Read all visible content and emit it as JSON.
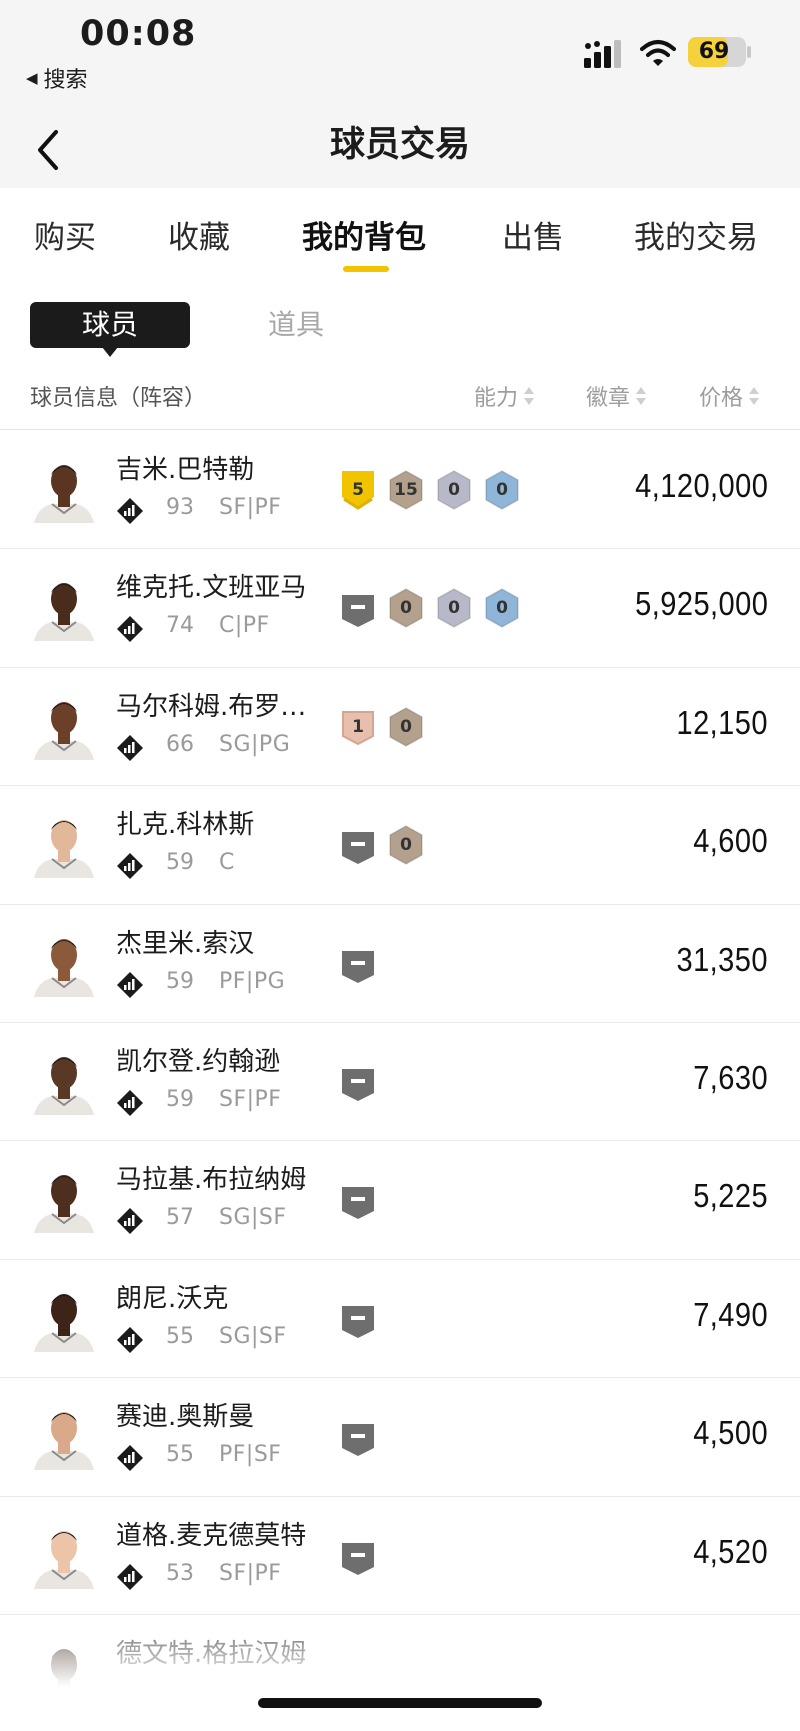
{
  "status": {
    "time": "00:08",
    "back_app": "搜索",
    "battery": "69",
    "battery_level": 0.69
  },
  "nav": {
    "title": "球员交易"
  },
  "tabs": [
    {
      "label": "购买",
      "active": false
    },
    {
      "label": "收藏",
      "active": false
    },
    {
      "label": "我的背包",
      "active": true
    },
    {
      "label": "出售",
      "active": false
    },
    {
      "label": "我的交易",
      "active": false
    }
  ],
  "segments": {
    "players": "球员",
    "props": "道具"
  },
  "header": {
    "info": "球员信息（阵容）",
    "ability": "能力",
    "badge": "徽章",
    "price": "价格"
  },
  "players": [
    {
      "name": "吉米.巴特勒",
      "rating": "93",
      "positions": "SF|PF",
      "skin": "#5a3622",
      "badges": [
        {
          "type": "gold",
          "value": "5"
        },
        {
          "type": "bronze",
          "value": "15"
        },
        {
          "type": "silver",
          "value": "0"
        },
        {
          "type": "blue",
          "value": "0"
        }
      ],
      "price": "4,120,000"
    },
    {
      "name": "维克托.文班亚马",
      "rating": "74",
      "positions": "C|PF",
      "skin": "#4a2c1c",
      "badges": [
        {
          "type": "empty",
          "value": ""
        },
        {
          "type": "bronze",
          "value": "0"
        },
        {
          "type": "silver",
          "value": "0"
        },
        {
          "type": "blue",
          "value": "0"
        }
      ],
      "price": "5,925,000"
    },
    {
      "name": "马尔科姆.布罗格登",
      "rating": "66",
      "positions": "SG|PG",
      "skin": "#6b3f28",
      "badges": [
        {
          "type": "pink",
          "value": "1"
        },
        {
          "type": "bronze",
          "value": "0"
        }
      ],
      "price": "12,150"
    },
    {
      "name": "扎克.科林斯",
      "rating": "59",
      "positions": "C",
      "skin": "#e2b79a",
      "badges": [
        {
          "type": "empty",
          "value": ""
        },
        {
          "type": "bronze",
          "value": "0"
        }
      ],
      "price": "4,600"
    },
    {
      "name": "杰里米.索汉",
      "rating": "59",
      "positions": "PF|PG",
      "skin": "#8a5a3a",
      "badges": [
        {
          "type": "empty",
          "value": ""
        }
      ],
      "price": "31,350"
    },
    {
      "name": "凯尔登.约翰逊",
      "rating": "59",
      "positions": "SF|PF",
      "skin": "#5a3826",
      "badges": [
        {
          "type": "empty",
          "value": ""
        }
      ],
      "price": "7,630"
    },
    {
      "name": "马拉基.布拉纳姆",
      "rating": "57",
      "positions": "SG|SF",
      "skin": "#4e2e1e",
      "badges": [
        {
          "type": "empty",
          "value": ""
        }
      ],
      "price": "5,225"
    },
    {
      "name": "朗尼.沃克",
      "rating": "55",
      "positions": "SG|SF",
      "skin": "#3e2418",
      "badges": [
        {
          "type": "empty",
          "value": ""
        }
      ],
      "price": "7,490"
    },
    {
      "name": "赛迪.奥斯曼",
      "rating": "55",
      "positions": "PF|SF",
      "skin": "#d9a98a",
      "badges": [
        {
          "type": "empty",
          "value": ""
        }
      ],
      "price": "4,500"
    },
    {
      "name": "道格.麦克德莫特",
      "rating": "53",
      "positions": "SF|PF",
      "skin": "#ecc4a8",
      "badges": [
        {
          "type": "empty",
          "value": ""
        }
      ],
      "price": "4,520"
    },
    {
      "name": "德文特.格拉汉姆",
      "rating": "",
      "positions": "",
      "skin": "#3e2418",
      "badges": [],
      "price": ""
    }
  ],
  "colors": {
    "accent": "#f4c300",
    "badge_gold": "#f2c400",
    "badge_bronze": "#b3a18d",
    "badge_silver": "#b7b9c8",
    "badge_blue": "#8fb6d9",
    "badge_pink": "#e8bfae",
    "badge_empty": "#6e6e6e"
  }
}
